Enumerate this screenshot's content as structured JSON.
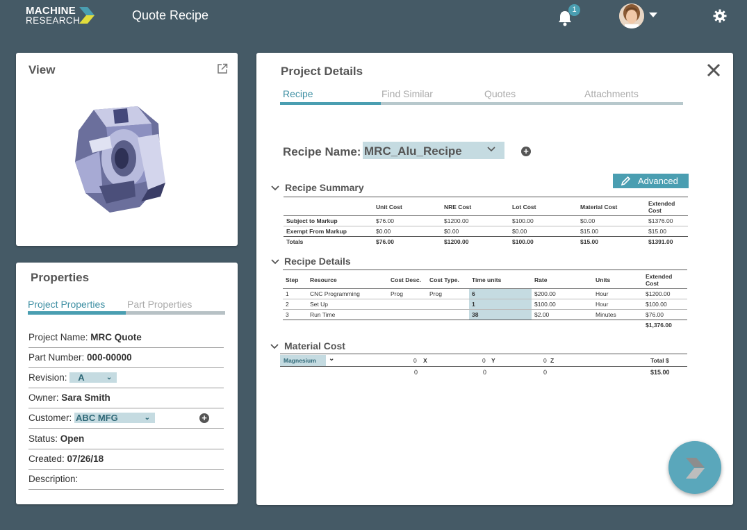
{
  "header": {
    "logo_line1": "MACHINE",
    "logo_line2": "RESEARCH",
    "app_title": "Quote Recipe",
    "notification_count": "1",
    "icons": [
      "bell-icon",
      "avatar",
      "gear-icon"
    ]
  },
  "view_card": {
    "title": "View"
  },
  "properties": {
    "title": "Properties",
    "tabs": [
      {
        "label": "Project Properties",
        "active": true
      },
      {
        "label": "Part Properties",
        "active": false
      }
    ],
    "fields": {
      "project_name_label": "Project Name:",
      "project_name_value": "MRC Quote",
      "part_number_label": "Part Number:",
      "part_number_value": "000-00000",
      "revision_label": "Revision:",
      "revision_value": "A",
      "owner_label": "Owner:",
      "owner_value": "Sara Smith",
      "customer_label": "Customer:",
      "customer_value": "ABC MFG",
      "status_label": "Status:",
      "status_value": "Open",
      "created_label": "Created:",
      "created_value": "07/26/18",
      "description_label": "Description:"
    }
  },
  "details": {
    "title": "Project Details",
    "tabs": [
      {
        "label": "Recipe",
        "active": true
      },
      {
        "label": "Find Similar",
        "active": false
      },
      {
        "label": "Quotes",
        "active": false
      },
      {
        "label": "Attachments",
        "active": false
      }
    ],
    "recipe_name_label": "Recipe Name:",
    "recipe_name_value": "MRC_Alu_Recipe",
    "advanced_label": "Advanced",
    "summary": {
      "heading": "Recipe Summary",
      "columns": [
        "",
        "Unit Cost",
        "NRE Cost",
        "Lot Cost",
        "Material Cost",
        "Extended Cost"
      ],
      "rows": [
        [
          "Subject to Markup",
          "$76.00",
          "$1200.00",
          "$100.00",
          "$0.00",
          "$1376.00"
        ],
        [
          "Exempt From Markup",
          "$0.00",
          "$0.00",
          "$0.00",
          "$15.00",
          "$15.00"
        ]
      ],
      "totals": [
        "Totals",
        "$76.00",
        "$1200.00",
        "$100.00",
        "$15.00",
        "$1391.00"
      ]
    },
    "recipe_details": {
      "heading": "Recipe Details",
      "columns": [
        "Step",
        "Resource",
        "Cost Desc.",
        "Cost Type.",
        "Time units",
        "Rate",
        "Units",
        "Extended Cost"
      ],
      "rows": [
        [
          "1",
          "CNC Programming",
          "Prog",
          "Prog",
          "6",
          "$200.00",
          "Hour",
          "$1200.00"
        ],
        [
          "2",
          "Set Up",
          "",
          "",
          "1",
          "$100.00",
          "Hour",
          "$100.00"
        ],
        [
          "3",
          "Run Time",
          "",
          "",
          "38",
          "$2.00",
          "Minutes",
          "$76.00"
        ]
      ],
      "total": "$1,376.00"
    },
    "material_cost": {
      "heading": "Material Cost",
      "material": "Magnesium",
      "x_value": "0",
      "x_label": "X",
      "y_value": "0",
      "y_label": "Y",
      "z_value": "0",
      "z_label": "Z",
      "total_label": "Total $",
      "row2_x": "0",
      "row2_y": "0",
      "row2_z": "0",
      "total_value": "$15.00"
    }
  },
  "colors": {
    "background": "#455a66",
    "accent": "#4a9eb1",
    "highlight": "#c5dbe1"
  }
}
